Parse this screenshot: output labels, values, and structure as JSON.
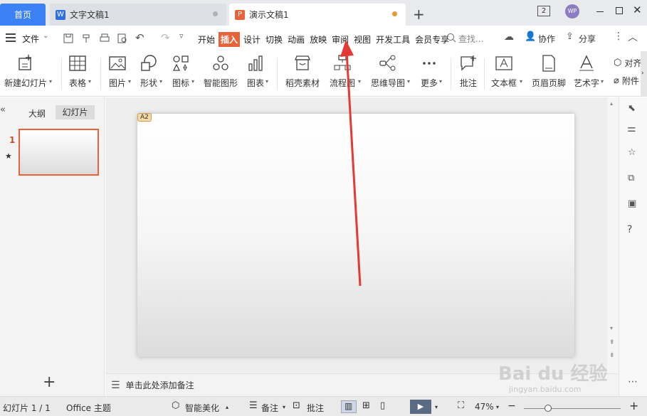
{
  "tabs": {
    "home": "首页",
    "doc": "文字文稿1",
    "ppt": "演示文稿1",
    "doc_icon": "W",
    "ppt_icon": "P",
    "doc_dot_color": "#aeb2b8",
    "ppt_dot_color": "#e89a2c",
    "accent": "#3c82f6"
  },
  "window": {
    "badge": "2",
    "avatar": "WP"
  },
  "menu": {
    "file": "文件",
    "items": [
      "开始",
      "插入",
      "设计",
      "切换",
      "动画",
      "放映",
      "审阅",
      "视图",
      "开发工具",
      "会员专享"
    ],
    "active": "插入",
    "search": "查找...",
    "collab": "协作",
    "share": "分享"
  },
  "ribbon": {
    "new_slide": "新建幻灯片",
    "table": "表格",
    "picture": "图片",
    "shape": "形状",
    "icon": "图标",
    "smart": "智能图形",
    "chart": "图表",
    "material": "稻壳素材",
    "flow": "流程图",
    "mind": "思维导图",
    "more": "更多",
    "comment": "批注",
    "textbox": "文本框",
    "header": "页眉页脚",
    "art": "艺术字",
    "align": "对齐",
    "attach": "附件"
  },
  "left": {
    "outline": "大纲",
    "slides": "幻灯片",
    "slide_no": "1"
  },
  "slide": {
    "tag": "A2"
  },
  "notes": {
    "placeholder": "单击此处添加备注"
  },
  "status": {
    "slide_info": "幻灯片 1 / 1",
    "theme": "Office 主题",
    "beautify": "智能美化",
    "notes": "备注",
    "comment": "批注",
    "zoom": "47%",
    "zoom_level": 0.47
  },
  "watermark": {
    "brand": "Bai du 经验",
    "url": "jingyan.baidu.com"
  },
  "arrow_color": "#e53935"
}
